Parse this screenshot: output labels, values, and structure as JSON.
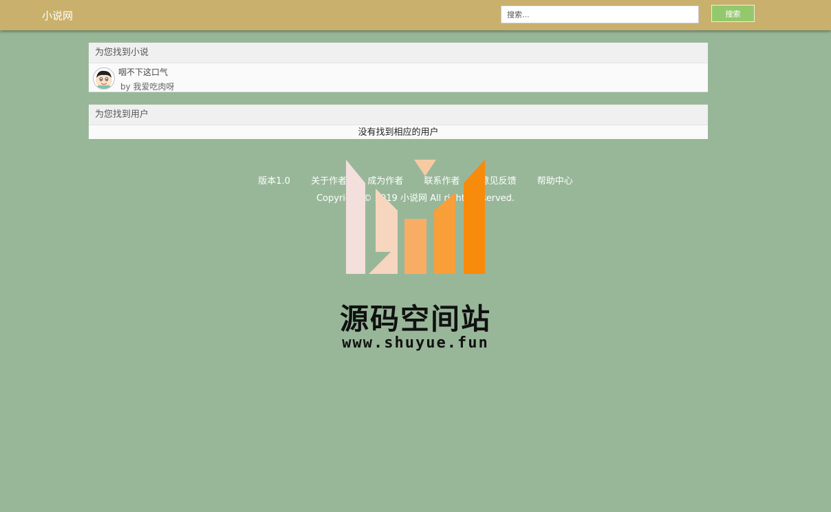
{
  "header": {
    "brand": "小说网",
    "search_placeholder": "搜索...",
    "search_button": "搜索"
  },
  "novels_section": {
    "heading": "为您找到小说",
    "items": [
      {
        "title": "咽不下这口气",
        "author": "by 我爱吃肉呀",
        "avatar_icon": "cartoon-avatar-icon"
      }
    ]
  },
  "users_section": {
    "heading": "为您找到用户",
    "empty_message": "没有找到相应的用户"
  },
  "footer": {
    "links": [
      "版本1.0",
      "关于作者",
      "成为作者",
      "联系作者",
      "意见反馈",
      "帮助中心"
    ],
    "copyright": "Copyright © 2019 小说网 All rights reserved."
  },
  "watermark": {
    "title": "源码空间站",
    "url": "www.shuyue.fun"
  },
  "colors": {
    "page_background": "#98b799",
    "header_background": "#c9b06c",
    "search_button": "#94c86d",
    "logo_pink": "#f2dede",
    "logo_orange": "#f88a0c"
  }
}
